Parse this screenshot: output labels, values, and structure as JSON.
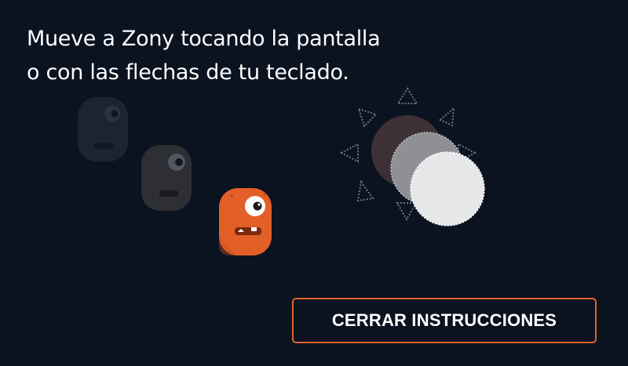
{
  "instructions": {
    "line1": "Mueve a Zony tocando la pantalla",
    "line2": "o con las flechas de tu teclado."
  },
  "close_button": {
    "label": "CERRAR INSTRUCCIONES"
  },
  "illustration": {
    "character": "zony-monster",
    "character_color": "#e35f28",
    "trail_copies": 2,
    "control_icon": "touch-circle-with-direction-arrows",
    "arrow_count": 8
  },
  "colors": {
    "background": "#0b1220",
    "accent": "#e0622a",
    "text": "#ffffff"
  }
}
